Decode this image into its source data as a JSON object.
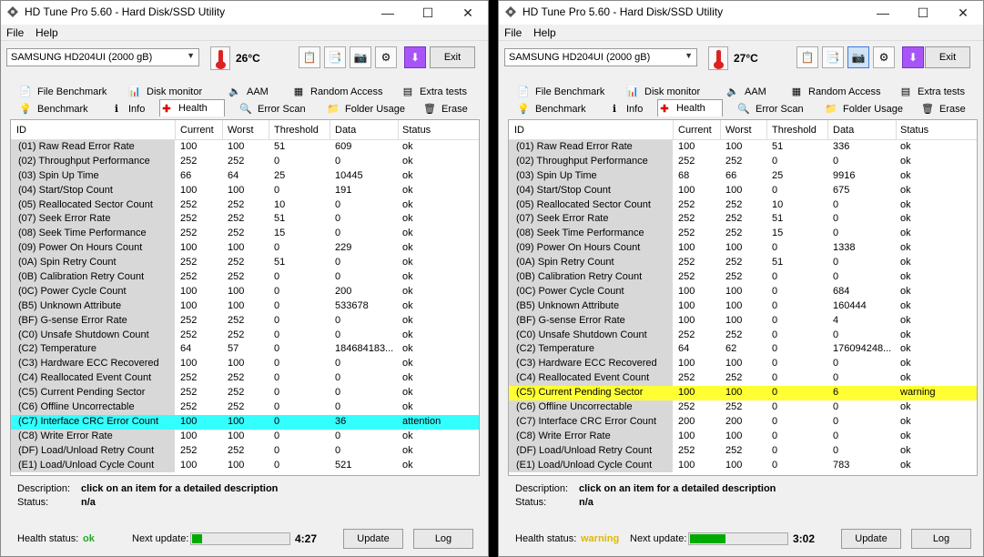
{
  "windows": [
    {
      "title": "HD Tune Pro 5.60 - Hard Disk/SSD Utility",
      "menu": [
        "File",
        "Help"
      ],
      "drive": "SAMSUNG HD204UI (2000 gB)",
      "temperature": "26°C",
      "exit_label": "Exit",
      "tabs_row1": [
        "File Benchmark",
        "Disk monitor",
        "AAM",
        "Random Access",
        "Extra tests"
      ],
      "tabs_row2": [
        "Benchmark",
        "Info",
        "Health",
        "Error Scan",
        "Folder Usage",
        "Erase"
      ],
      "active_tab": "Health",
      "columns": [
        "ID",
        "Current",
        "Worst",
        "Threshold",
        "Data",
        "Status"
      ],
      "rows": [
        [
          "(01) Raw Read Error Rate",
          "100",
          "100",
          "51",
          "609",
          "ok"
        ],
        [
          "(02) Throughput Performance",
          "252",
          "252",
          "0",
          "0",
          "ok"
        ],
        [
          "(03) Spin Up Time",
          "66",
          "64",
          "25",
          "10445",
          "ok"
        ],
        [
          "(04) Start/Stop Count",
          "100",
          "100",
          "0",
          "191",
          "ok"
        ],
        [
          "(05) Reallocated Sector Count",
          "252",
          "252",
          "10",
          "0",
          "ok"
        ],
        [
          "(07) Seek Error Rate",
          "252",
          "252",
          "51",
          "0",
          "ok"
        ],
        [
          "(08) Seek Time Performance",
          "252",
          "252",
          "15",
          "0",
          "ok"
        ],
        [
          "(09) Power On Hours Count",
          "100",
          "100",
          "0",
          "229",
          "ok"
        ],
        [
          "(0A) Spin Retry Count",
          "252",
          "252",
          "51",
          "0",
          "ok"
        ],
        [
          "(0B) Calibration Retry Count",
          "252",
          "252",
          "0",
          "0",
          "ok"
        ],
        [
          "(0C) Power Cycle Count",
          "100",
          "100",
          "0",
          "200",
          "ok"
        ],
        [
          "(B5) Unknown Attribute",
          "100",
          "100",
          "0",
          "533678",
          "ok"
        ],
        [
          "(BF) G-sense Error Rate",
          "252",
          "252",
          "0",
          "0",
          "ok"
        ],
        [
          "(C0) Unsafe Shutdown Count",
          "252",
          "252",
          "0",
          "0",
          "ok"
        ],
        [
          "(C2) Temperature",
          "64",
          "57",
          "0",
          "184684183...",
          "ok"
        ],
        [
          "(C3) Hardware ECC Recovered",
          "100",
          "100",
          "0",
          "0",
          "ok"
        ],
        [
          "(C4) Reallocated Event Count",
          "252",
          "252",
          "0",
          "0",
          "ok"
        ],
        [
          "(C5) Current Pending Sector",
          "252",
          "252",
          "0",
          "0",
          "ok"
        ],
        [
          "(C6) Offline Uncorrectable",
          "252",
          "252",
          "0",
          "0",
          "ok"
        ],
        [
          "(C7) Interface CRC Error Count",
          "100",
          "100",
          "0",
          "36",
          "attention"
        ],
        [
          "(C8) Write Error Rate",
          "100",
          "100",
          "0",
          "0",
          "ok"
        ],
        [
          "(DF) Load/Unload Retry Count",
          "252",
          "252",
          "0",
          "0",
          "ok"
        ],
        [
          "(E1) Load/Unload Cycle Count",
          "100",
          "100",
          "0",
          "521",
          "ok"
        ]
      ],
      "highlight_row": 19,
      "highlight_color": "#33ffff",
      "description_label": "Description:",
      "description_value": "click on an item for a detailed description",
      "status_label": "Status:",
      "status_value": "n/a",
      "health_label": "Health status:",
      "health_value": "ok",
      "health_color": "#22aa22",
      "next_update_label": "Next update:",
      "next_update_progress": 0.1,
      "next_update_time": "4:27",
      "update_label": "Update",
      "log_label": "Log"
    },
    {
      "title": "HD Tune Pro 5.60 - Hard Disk/SSD Utility",
      "menu": [
        "File",
        "Help"
      ],
      "drive": "SAMSUNG HD204UI (2000 gB)",
      "temperature": "27°C",
      "exit_label": "Exit",
      "tabs_row1": [
        "File Benchmark",
        "Disk monitor",
        "AAM",
        "Random Access",
        "Extra tests"
      ],
      "tabs_row2": [
        "Benchmark",
        "Info",
        "Health",
        "Error Scan",
        "Folder Usage",
        "Erase"
      ],
      "active_tab": "Health",
      "columns": [
        "ID",
        "Current",
        "Worst",
        "Threshold",
        "Data",
        "Status"
      ],
      "rows": [
        [
          "(01) Raw Read Error Rate",
          "100",
          "100",
          "51",
          "336",
          "ok"
        ],
        [
          "(02) Throughput Performance",
          "252",
          "252",
          "0",
          "0",
          "ok"
        ],
        [
          "(03) Spin Up Time",
          "68",
          "66",
          "25",
          "9916",
          "ok"
        ],
        [
          "(04) Start/Stop Count",
          "100",
          "100",
          "0",
          "675",
          "ok"
        ],
        [
          "(05) Reallocated Sector Count",
          "252",
          "252",
          "10",
          "0",
          "ok"
        ],
        [
          "(07) Seek Error Rate",
          "252",
          "252",
          "51",
          "0",
          "ok"
        ],
        [
          "(08) Seek Time Performance",
          "252",
          "252",
          "15",
          "0",
          "ok"
        ],
        [
          "(09) Power On Hours Count",
          "100",
          "100",
          "0",
          "1338",
          "ok"
        ],
        [
          "(0A) Spin Retry Count",
          "252",
          "252",
          "51",
          "0",
          "ok"
        ],
        [
          "(0B) Calibration Retry Count",
          "252",
          "252",
          "0",
          "0",
          "ok"
        ],
        [
          "(0C) Power Cycle Count",
          "100",
          "100",
          "0",
          "684",
          "ok"
        ],
        [
          "(B5) Unknown Attribute",
          "100",
          "100",
          "0",
          "160444",
          "ok"
        ],
        [
          "(BF) G-sense Error Rate",
          "100",
          "100",
          "0",
          "4",
          "ok"
        ],
        [
          "(C0) Unsafe Shutdown Count",
          "252",
          "252",
          "0",
          "0",
          "ok"
        ],
        [
          "(C2) Temperature",
          "64",
          "62",
          "0",
          "176094248...",
          "ok"
        ],
        [
          "(C3) Hardware ECC Recovered",
          "100",
          "100",
          "0",
          "0",
          "ok"
        ],
        [
          "(C4) Reallocated Event Count",
          "252",
          "252",
          "0",
          "0",
          "ok"
        ],
        [
          "(C5) Current Pending Sector",
          "100",
          "100",
          "0",
          "6",
          "warning"
        ],
        [
          "(C6) Offline Uncorrectable",
          "252",
          "252",
          "0",
          "0",
          "ok"
        ],
        [
          "(C7) Interface CRC Error Count",
          "200",
          "200",
          "0",
          "0",
          "ok"
        ],
        [
          "(C8) Write Error Rate",
          "100",
          "100",
          "0",
          "0",
          "ok"
        ],
        [
          "(DF) Load/Unload Retry Count",
          "252",
          "252",
          "0",
          "0",
          "ok"
        ],
        [
          "(E1) Load/Unload Cycle Count",
          "100",
          "100",
          "0",
          "783",
          "ok"
        ]
      ],
      "highlight_row": 17,
      "highlight_color": "#ffff33",
      "description_label": "Description:",
      "description_value": "click on an item for a detailed description",
      "status_label": "Status:",
      "status_value": "n/a",
      "health_label": "Health status:",
      "health_value": "warning",
      "health_color": "#e0b800",
      "next_update_label": "Next update:",
      "next_update_progress": 0.37,
      "next_update_time": "3:02",
      "update_label": "Update",
      "log_label": "Log"
    }
  ]
}
